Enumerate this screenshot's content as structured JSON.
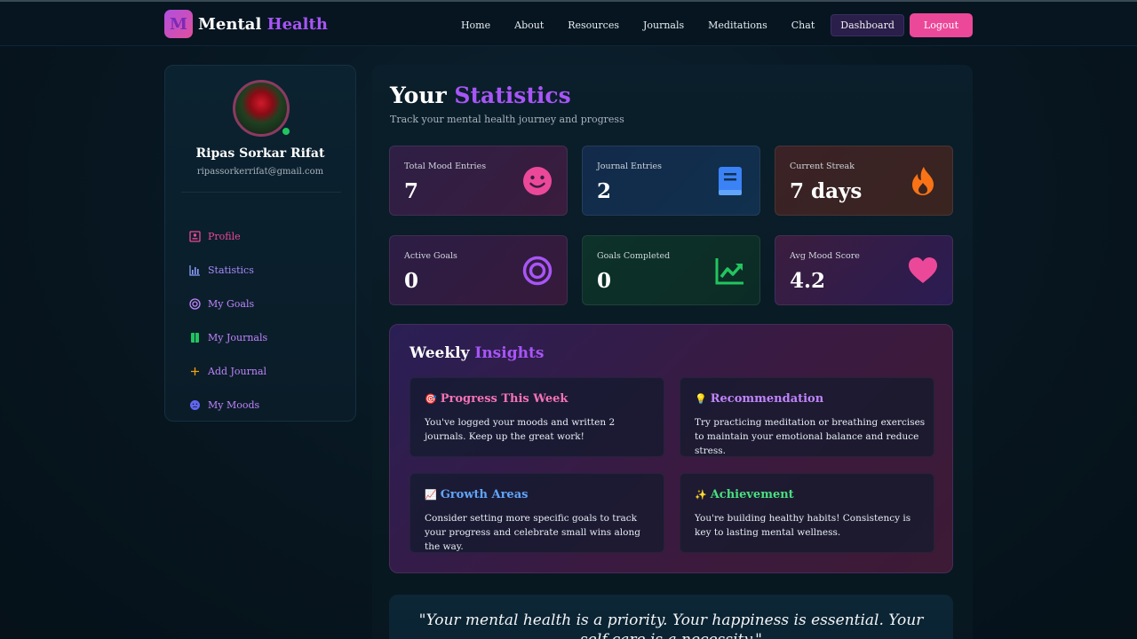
{
  "brand": {
    "logo_letter": "M",
    "name_part1": "Mental",
    "name_part2": "Health"
  },
  "nav": {
    "links": [
      "Home",
      "About",
      "Resources",
      "Journals",
      "Meditations",
      "Chat"
    ],
    "dashboard": "Dashboard",
    "logout": "Logout"
  },
  "sidebar": {
    "user_name": "Ripas Sorkar Rifat",
    "user_email": "ripassorkerrifat@gmail.com",
    "items": [
      {
        "label": "Profile",
        "icon": "profile-icon"
      },
      {
        "label": "Statistics",
        "icon": "chart-icon"
      },
      {
        "label": "My Goals",
        "icon": "target-icon"
      },
      {
        "label": "My Journals",
        "icon": "book-icon"
      },
      {
        "label": "Add Journal",
        "icon": "plus-icon"
      },
      {
        "label": "My Moods",
        "icon": "mood-icon"
      }
    ]
  },
  "main": {
    "title_part1": "Your",
    "title_part2": "Statistics",
    "subtitle": "Track your mental health journey and progress",
    "cards": [
      {
        "label": "Total Mood Entries",
        "value": "7",
        "icon": "smile-icon"
      },
      {
        "label": "Journal Entries",
        "value": "2",
        "icon": "book-icon"
      },
      {
        "label": "Current Streak",
        "value": "7 days",
        "icon": "fire-icon"
      },
      {
        "label": "Active Goals",
        "value": "0",
        "icon": "target-icon"
      },
      {
        "label": "Goals Completed",
        "value": "0",
        "icon": "trending-up-icon"
      },
      {
        "label": "Avg Mood Score",
        "value": "4.2",
        "icon": "heart-icon"
      }
    ],
    "insights": {
      "title_part1": "Weekly",
      "title_part2": "Insights",
      "cards": [
        {
          "emoji": "🎯",
          "title": "Progress This Week",
          "body": "You've logged your moods and written 2 journals. Keep up the great work!"
        },
        {
          "emoji": "💡",
          "title": "Recommendation",
          "body": "Try practicing meditation or breathing exercises to maintain your emotional balance and reduce stress."
        },
        {
          "emoji": "📈",
          "title": "Growth Areas",
          "body": "Consider setting more specific goals to track your progress and celebrate small wins along the way."
        },
        {
          "emoji": "✨",
          "title": "Achievement",
          "body": "You're building healthy habits! Consistency is key to lasting mental wellness."
        }
      ]
    },
    "quote": "\"Your mental health is a priority. Your happiness is essential. Your self-care is a necessity.\""
  },
  "colors": {
    "accent_purple": "#a855f7",
    "accent_pink": "#ec4899",
    "online": "#22c55e"
  }
}
